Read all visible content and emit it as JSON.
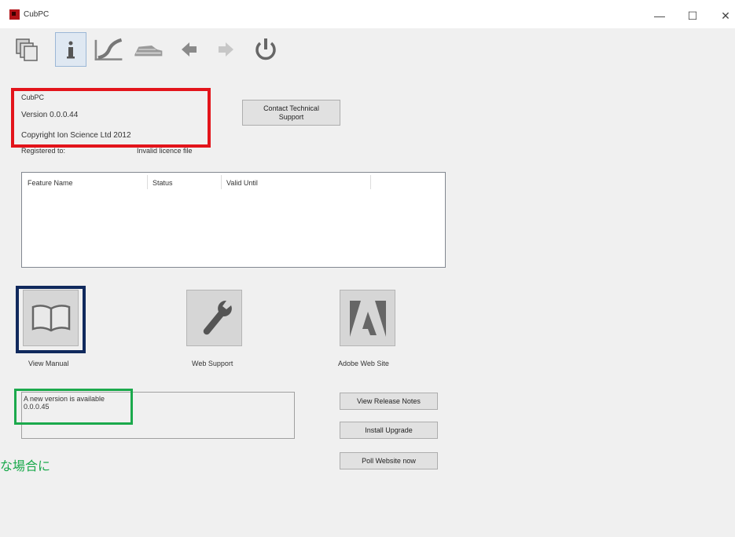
{
  "window": {
    "title": "CubPC",
    "minimize": "—",
    "maximize": "☐",
    "close": "✕"
  },
  "toolbar": {
    "items": [
      {
        "name": "copy-icon"
      },
      {
        "name": "info-icon"
      },
      {
        "name": "curve-icon"
      },
      {
        "name": "truck-icon"
      },
      {
        "name": "back-arrow-icon"
      },
      {
        "name": "forward-arrow-icon"
      },
      {
        "name": "power-icon"
      }
    ]
  },
  "about": {
    "app_name": "CubPC",
    "version": "Version 0.0.0.44",
    "copyright": "Copyright Ion Science Ltd 2012",
    "registered_label": "Registered to:",
    "registered_value": "Invalid licence file",
    "contact_button": "Contact Technical Support"
  },
  "features_table": {
    "columns": [
      "Feature Name",
      "Status",
      "Valid Until"
    ],
    "rows": []
  },
  "links": {
    "manual": "View Manual",
    "web_support": "Web Support",
    "adobe": "Adobe Web Site"
  },
  "update": {
    "message_line1": "A new version is available",
    "message_line2": "0.0.0.45",
    "view_release_notes": "View Release Notes",
    "install_upgrade": "Install Upgrade",
    "poll_website": "Poll Website now"
  },
  "annotation": {
    "japanese_text": "な場合に"
  },
  "colors": {
    "red_box": "#e3141b",
    "navy_box": "#10295d",
    "green_box": "#1ba94c"
  }
}
